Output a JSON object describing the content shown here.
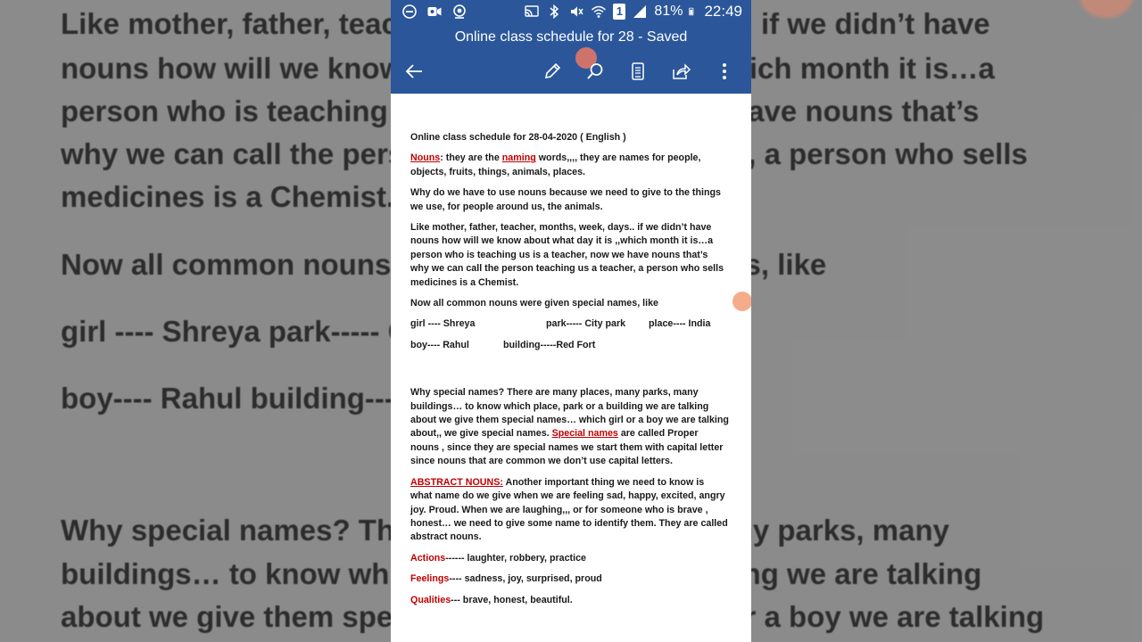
{
  "background_lines": [
    "Like mother, father, teacher, months, week, days.. if we didn’t have",
    "nouns how will we know about what day it is ,,which month it is…a",
    "person who is teaching us is a teacher, now we have nouns that’s",
    "why we can call the person teaching us a teacher, a person who sells",
    "medicines is a Chemist.",
    "Now all common nouns were given special names, like",
    "girl ---- Shreya                     park----- City park          place---- India",
    "boy----  Rahul              building-----Red Fort",
    "Why special names? There are many places, many parks, many",
    "buildings… to know which place, park or a building we are talking",
    "about we give them special names… which girl or a boy we are talking"
  ],
  "status_bar": {
    "battery": "81%",
    "time": "22:49",
    "sim": "1"
  },
  "app_bar": {
    "title": "Online class schedule for 28 - Saved",
    "back_icon": "arrow-left-icon",
    "edit_icon": "pencil-icon",
    "search_icon": "search-icon",
    "view_icon": "mobile-view-icon",
    "share_icon": "share-icon",
    "more_icon": "more-vertical-icon"
  },
  "document": {
    "heading": "Online class schedule for 28-04-2020 ( English )",
    "nouns_label": "Nouns",
    "nouns_line1_a": ":  they are the ",
    "nouns_naming": "naming",
    "nouns_line1_b": " words,,,, they are names for people,",
    "nouns_line2": "objects, fruits, things, animals, places.",
    "why_line1": "Why do we have to use nouns because we need to give to the things",
    "why_line2": "we use, for people around us, the animals.",
    "like_line1": "Like mother, father, teacher, months, week, days.. if we didn’t have",
    "like_line2": "nouns how will we know about what day it is ,,which month it is…a",
    "like_line3": "person who is teaching us is a teacher, now we have nouns that’s",
    "like_line4": "why we can call the person teaching us a teacher, a person who sells",
    "like_line5": "medicines is a Chemist.",
    "common_line": "Now all common nouns were given special names, like",
    "girl": "girl ---- Shreya",
    "park": "park----- City park",
    "place": "place---- India",
    "boy": "boy----  Rahul",
    "building": "building-----Red Fort",
    "special_line1": "Why special names? There are many places, many parks, many",
    "special_line2": "buildings… to know which place, park or a building we are talking",
    "special_line3": "about we give them special names… which girl or a boy we are talking",
    "special_line4_a": "about,, we give special names. ",
    "special_names": "Special names",
    "special_line4_b": " are called Proper",
    "special_line5": "nouns , since they are special names we start them with capital letter",
    "special_line6": "since nouns that are common we don’t use capital letters.",
    "abstract_label": "ABSTRACT NOUNS:",
    "abstract_line1": "  Another important thing we need to know is",
    "abstract_line2": "what name do we give when we are feeling sad, happy, excited, angry",
    "abstract_line3": "joy. Proud.  When we are laughing,,, or for someone who is brave ,",
    "abstract_line4": "honest… we need to give some name to identify them. They are called",
    "abstract_line5": "abstract nouns.",
    "actions_label": "Actions",
    "actions_text": "------ laughter, robbery, practice",
    "feelings_label": "Feelings",
    "feelings_text": "---- sadness, joy, surprised, proud",
    "qualities_label": "Qualities",
    "qualities_text": "--- brave, honest, beautiful."
  },
  "colors": {
    "word_blue": "#2b579a",
    "accent_red": "#c00000"
  }
}
